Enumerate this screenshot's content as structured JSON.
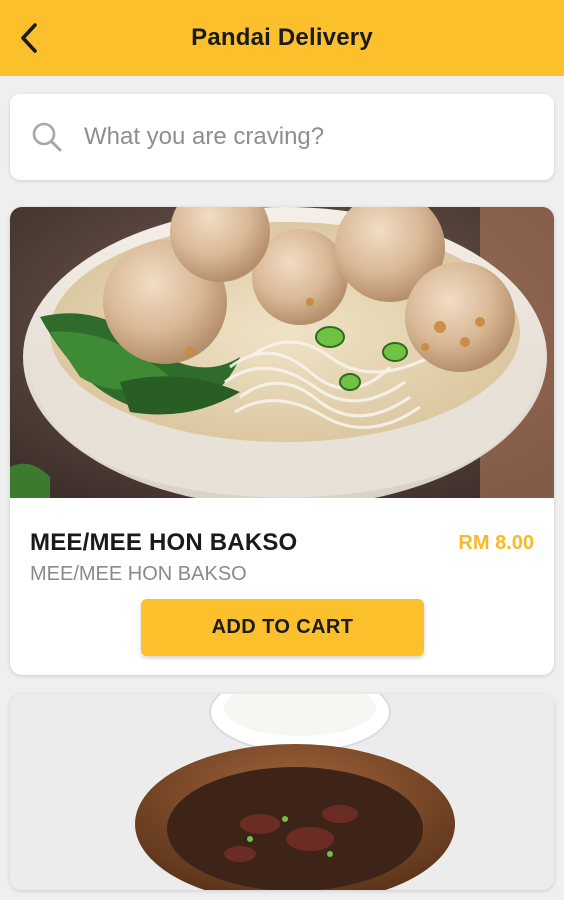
{
  "header": {
    "title": "Pandai Delivery",
    "back_icon": "chevron-left-icon",
    "color": "#fcc02d"
  },
  "search": {
    "placeholder": "What you are craving?",
    "value": "",
    "icon": "search-icon"
  },
  "menu_items": [
    {
      "name": "MEE/MEE HON BAKSO",
      "description": "MEE/MEE HON BAKSO",
      "price": "RM 8.00",
      "button_label": "ADD TO CART"
    }
  ],
  "colors": {
    "accent": "#fcc02d",
    "price": "#f7b928",
    "background": "#efefef"
  }
}
